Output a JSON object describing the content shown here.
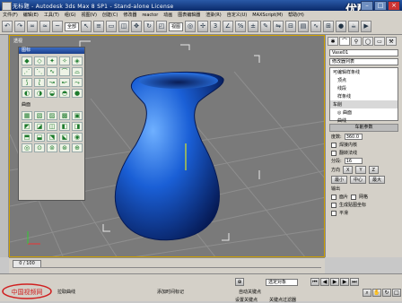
{
  "window": {
    "title": "无标题 - Autodesk 3ds Max 8 SP1 - Stand-alone License",
    "watermark": "优酷"
  },
  "menubar": {
    "items": [
      "文件(F)",
      "编辑(E)",
      "工具(T)",
      "组(G)",
      "视图(V)",
      "创建(C)",
      "修改器",
      "reactor",
      "动画",
      "图表编辑器",
      "渲染(R)",
      "自定义(U)",
      "MAXScript(M)",
      "帮助(H)"
    ]
  },
  "toolbar": {
    "selection_filter": "全部",
    "view_dropdown": "视图"
  },
  "viewport": {
    "label": "透视"
  },
  "palette": {
    "title": "图标",
    "section_label": "曲面"
  },
  "command_panel": {
    "object_name": "Vase01",
    "modifier_list": "修改器列表",
    "stack": [
      "可编辑样条线",
      "顶点",
      "线段",
      "样条线",
      "车削",
      "◎ 曲面",
      "曲线"
    ],
    "rollout_title": "车削参数",
    "degrees_label": "度数:",
    "degrees_value": "360.0",
    "weld_core": "焊接内核",
    "flip_normals": "翻转法线",
    "segments_label": "分段:",
    "segments_value": "16",
    "cap_label": "封口",
    "direction_label": "方向",
    "dir_x": "X",
    "dir_y": "Y",
    "dir_z": "Z",
    "align_label": "对齐",
    "align_min": "最小",
    "align_center": "中心",
    "align_max": "最大",
    "output_label": "输出",
    "output_mesh": "面片",
    "output_grid": "网格",
    "output_nurbs": "NURBS",
    "gen_mapping": "生成贴图坐标",
    "gen_matid": "生成材质ID",
    "use_shape_ids": "使用图形ID",
    "smooth": "平滑"
  },
  "timeline": {
    "slider": "0 / 100"
  },
  "statusbar": {
    "left_label": "拉取曲线",
    "add_time_tag": "添加时间标记",
    "auto_key": "自动关键点",
    "selected_obj": "选定对象",
    "set_key": "设置关键点",
    "key_filters": "关键点过滤器",
    "brand": "中国视频网"
  },
  "colors": {
    "vase": "#1a5fd6",
    "viewport_bg": "#7a7a7a",
    "title_bar": "#0a2a6a"
  }
}
